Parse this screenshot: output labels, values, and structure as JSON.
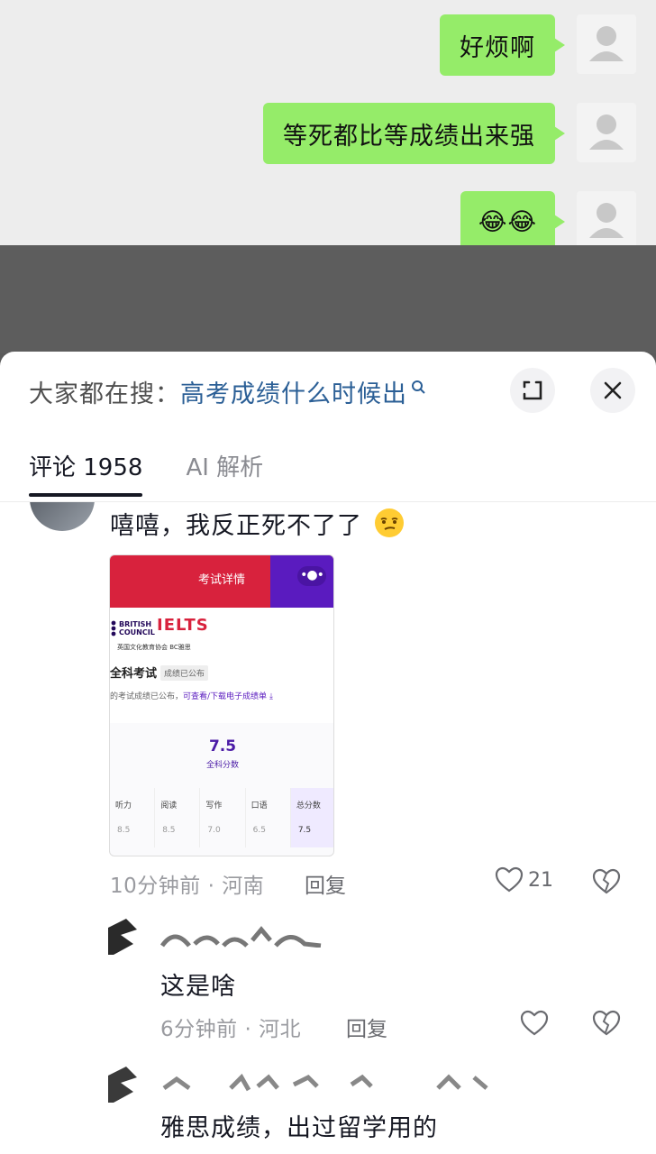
{
  "video": {
    "messages": [
      {
        "text": "好烦啊"
      },
      {
        "text": "等死都比等成绩出来强"
      },
      {
        "text": "😂😂"
      }
    ]
  },
  "search_bar": {
    "prefix": "大家都在搜：",
    "query": "高考成绩什么时候出"
  },
  "tabs": [
    {
      "label": "评论 1958",
      "active": true
    },
    {
      "label": "AI 解析",
      "active": false
    }
  ],
  "comments": [
    {
      "text": "嘻嘻，我反正死不了了",
      "emoji": "smirk-face-icon",
      "image": {
        "header": "考试详情",
        "logo_text": [
          "BRITISH",
          "COUNCIL"
        ],
        "brand": "IELTS",
        "brand_sub": "英国文化教育协会 BC雅思",
        "exam_name": "全科考试",
        "exam_status": "成绩已公布",
        "note_prefix": "的考试成绩已公布，",
        "note_link": "可查看/下载电子成绩单",
        "overall_score": "7.5",
        "overall_label": "全科分数",
        "columns": [
          {
            "head": "听力",
            "value": "8.5"
          },
          {
            "head": "阅读",
            "value": "8.5"
          },
          {
            "head": "写作",
            "value": "7.0"
          },
          {
            "head": "口语",
            "value": "6.5"
          },
          {
            "head": "总分数",
            "value": "7.5"
          }
        ]
      },
      "time": "10分钟前 · 河南",
      "reply_label": "回复",
      "likes": "21"
    },
    {
      "text": "这是啥",
      "time": "6分钟前 · 河北",
      "reply_label": "回复"
    },
    {
      "text": "雅思成绩，出过留学用的"
    }
  ],
  "colors": {
    "bubble_green": "#95ec69",
    "link_blue": "#2b5f96",
    "ielts_red": "#d8223d",
    "ielts_purple": "#5a1bbf"
  }
}
